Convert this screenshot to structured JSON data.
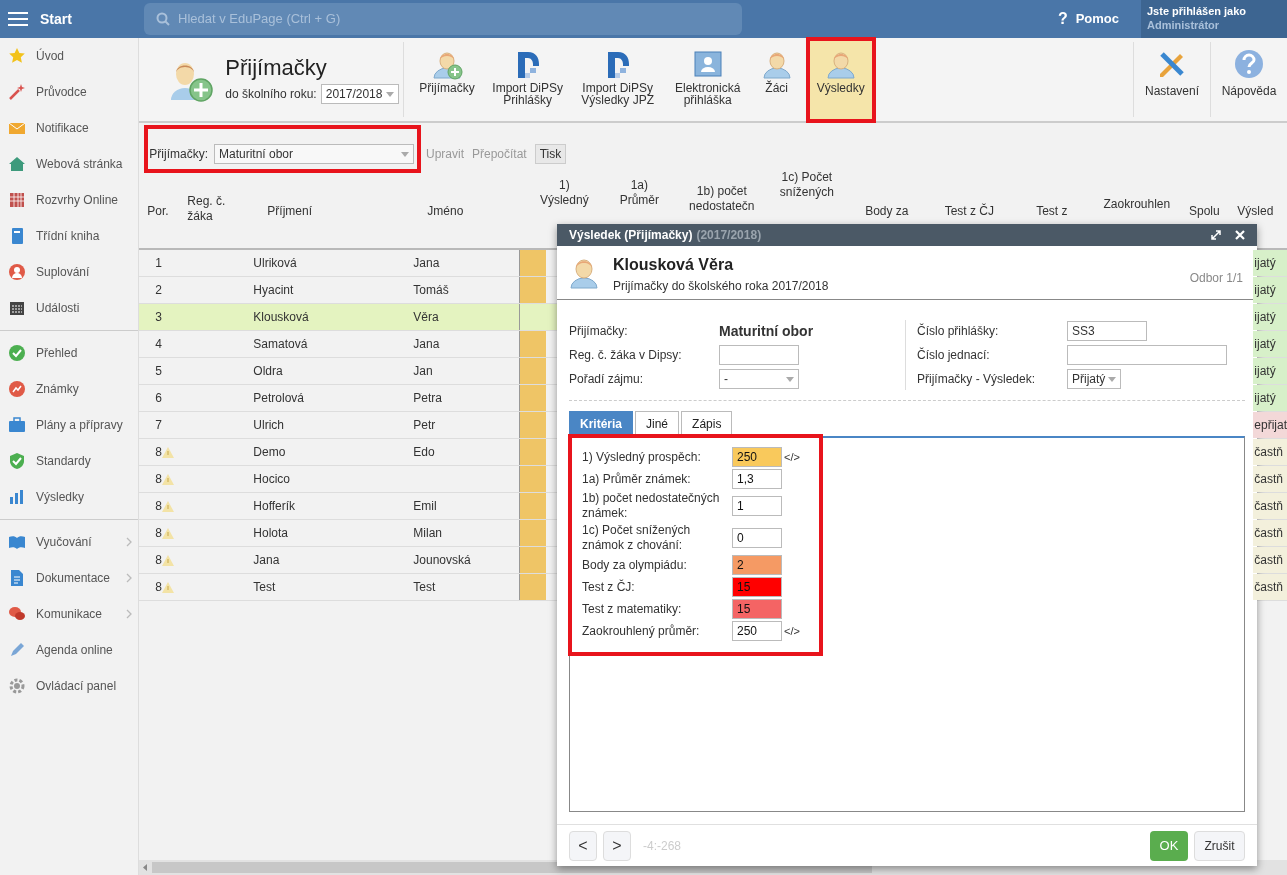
{
  "topbar": {
    "menu_label": "Start",
    "search_placeholder": "Hledat v EduPage (Ctrl + G)",
    "help_glyph": "?",
    "help": "Pomoc",
    "user_caption": "Jste přihlášen jako",
    "user_role": "Administrátor"
  },
  "sidebar": {
    "groups": [
      [
        {
          "label": "Úvod"
        },
        {
          "label": "Průvodce"
        },
        {
          "label": "Notifikace"
        },
        {
          "label": "Webová stránka"
        },
        {
          "label": "Rozvrhy Online"
        },
        {
          "label": "Třídní kniha"
        },
        {
          "label": "Suplování"
        },
        {
          "label": "Události"
        }
      ],
      [
        {
          "label": "Přehled"
        },
        {
          "label": "Známky"
        },
        {
          "label": "Plány a přípravy"
        },
        {
          "label": "Standardy"
        },
        {
          "label": "Výsledky"
        }
      ],
      [
        {
          "label": "Vyučování",
          "has_submenu": true
        },
        {
          "label": "Dokumentace",
          "has_submenu": true
        },
        {
          "label": "Komunikace",
          "has_submenu": true
        },
        {
          "label": "Agenda online",
          "has_submenu": false
        },
        {
          "label": "Ovládací panel",
          "has_submenu": false
        }
      ]
    ]
  },
  "page_header": {
    "title": "Přijímačky",
    "year_label": "do školního roku:",
    "year": "2017/2018"
  },
  "toolbar": [
    {
      "label": "Přijímačky",
      "selected": false
    },
    {
      "label": "Import DiPSy Prihlášky",
      "selected": false
    },
    {
      "label": "Import DiPSy Výsledky JPZ",
      "selected": false
    },
    {
      "label": "Elektronická přihláška",
      "selected": false
    },
    {
      "label": "Žáci",
      "selected": false
    },
    {
      "label": "Výsledky",
      "selected": true
    }
  ],
  "toolbar_right": [
    {
      "label": "Nastavení"
    },
    {
      "label": "Nápověda"
    }
  ],
  "filter": {
    "label": "Přijímačky:",
    "value": "Maturitní obor",
    "actions": [
      {
        "label": "Upravit",
        "disabled": true
      },
      {
        "label": "Přepočítat",
        "disabled": true
      }
    ],
    "print": "Tisk"
  },
  "table": {
    "columns": [
      "Por.",
      "Reg. č.\nžáka",
      "Příjmení",
      "Jméno",
      "1)\nVýsledný",
      "1a)\nPrůměr",
      "1b) počet\nnedostatečn",
      "1c) Počet\nsnížených",
      "Body za",
      "Test z ČJ",
      "Test z",
      "Zaokrouhlen",
      "Spolu",
      "Výsled"
    ],
    "rows": [
      {
        "order": "1",
        "warning": false,
        "surname": "Ulriková",
        "first_name": "Jana",
        "result": "ijatý",
        "color": "#d7f0c9",
        "selected": false
      },
      {
        "order": "2",
        "warning": false,
        "surname": "Hyacint",
        "first_name": "Tomáš",
        "result": "ijatý",
        "color": "#d7f0c9",
        "selected": false
      },
      {
        "order": "3",
        "warning": false,
        "surname": "Klousková",
        "first_name": "Věra",
        "result": "ijatý",
        "color": "#d7f0c9",
        "selected": true
      },
      {
        "order": "4",
        "warning": false,
        "surname": "Samatová",
        "first_name": "Jana",
        "result": "ijatý",
        "color": "#d7f0c9",
        "selected": false
      },
      {
        "order": "5",
        "warning": false,
        "surname": "Oldra",
        "first_name": "Jan",
        "result": "ijatý",
        "color": "#d7f0c9",
        "selected": false
      },
      {
        "order": "6",
        "warning": false,
        "surname": "Petrolová",
        "first_name": "Petra",
        "result": "ijatý",
        "color": "#d7f0c9",
        "selected": false
      },
      {
        "order": "7",
        "warning": false,
        "surname": "Ulrich",
        "first_name": "Petr",
        "result": "epřijat",
        "color": "#f3d8d8",
        "selected": false
      },
      {
        "order": "8",
        "warning": true,
        "surname": "Demo",
        "first_name": "Edo",
        "result": "častň",
        "color": "#f3f0dc",
        "selected": false
      },
      {
        "order": "8",
        "warning": true,
        "surname": "Hocico",
        "result": "častň",
        "color": "#f3f0dc",
        "selected": false
      },
      {
        "order": "8",
        "warning": true,
        "surname": "Hofferík",
        "first_name": "Emil",
        "result": "častň",
        "color": "#f3f0dc",
        "selected": false
      },
      {
        "order": "8",
        "warning": true,
        "surname": "Holota",
        "first_name": "Milan",
        "result": "častň",
        "color": "#f3f0dc",
        "selected": false
      },
      {
        "order": "8",
        "warning": true,
        "surname": "Jana",
        "first_name": "Jounovská",
        "result": "častň",
        "color": "#f3f0dc",
        "selected": false
      },
      {
        "order": "8",
        "warning": true,
        "surname": "Test",
        "first_name": "Test",
        "result": "častň",
        "color": "#f3f0dc",
        "selected": false
      }
    ]
  },
  "dialog": {
    "title": "Výsledek (Přijímačky)",
    "title_year": "(2017/2018)",
    "student_name": "Klousková Věra",
    "subtitle": "Prijímačky do školského roka 2017/2018",
    "branch": "Odbor 1/1",
    "fields_left": [
      {
        "label": "Přijímačky:",
        "value": "Maturitní obor",
        "kind": "static"
      },
      {
        "label": "Reg. č. žáka v Dipsy:",
        "kind": "input"
      },
      {
        "label": "Pořadí zájmu:",
        "value": "-",
        "kind": "select"
      }
    ],
    "fields_right": [
      {
        "label": "Číslo přihlášky:",
        "value": "SS3",
        "kind": "input"
      },
      {
        "label": "Číslo jednací:",
        "kind": "input"
      },
      {
        "label": "Přijímačky - Výsledek:",
        "value": "Přijatý",
        "kind": "select"
      }
    ],
    "tabs": [
      {
        "label": "Kritéria",
        "selected": true
      },
      {
        "label": "Jiné",
        "selected": false
      },
      {
        "label": "Zápis",
        "selected": false
      }
    ],
    "criteria": [
      {
        "label": "1) Výsledný prospěch:",
        "value": "250",
        "color": "#f9c95c",
        "suffix": "</>"
      },
      {
        "label": "1a) Průměr známek:",
        "value": "1,3"
      },
      {
        "label": "1b) počet nedostatečných známek:",
        "value": "1"
      },
      {
        "label": "1c) Počet snížených známok z chování:",
        "value": "0"
      },
      {
        "label": "Body za olympiádu:",
        "value": "2",
        "color": "#f59a64"
      },
      {
        "label": "Test z ČJ:",
        "value": "15",
        "color": "#ff0000"
      },
      {
        "label": "Test z matematiky:",
        "value": "15",
        "color": "#f46464"
      },
      {
        "label": "Zaokrouhlený průměr:",
        "value": "250",
        "suffix": "</>"
      }
    ],
    "nav": [
      "<",
      ">"
    ],
    "record_info": "-4:-268",
    "ok": "OK",
    "cancel": "Zrušit"
  }
}
